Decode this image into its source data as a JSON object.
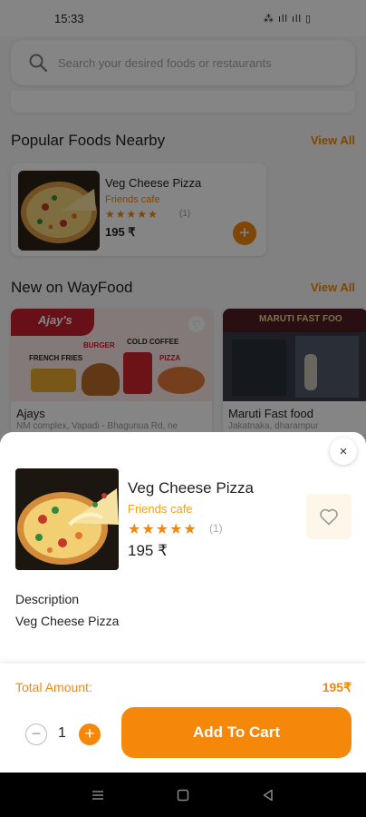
{
  "status_bar": {
    "time": "15:33",
    "icons": "⁂ ıll ıll ▯"
  },
  "search": {
    "placeholder": "Search your desired foods or restaurants"
  },
  "popular": {
    "title": "Popular Foods Nearby",
    "view_all": "View All",
    "item": {
      "name": "Veg Cheese Pizza",
      "restaurant": "Friends cafe",
      "stars": "★★★★★",
      "rating_count": "(1)",
      "price": "195 ₹"
    }
  },
  "new_on": {
    "title": "New on WayFood",
    "view_all": "View All",
    "items": [
      {
        "name": "Ajays",
        "address": "NM complex, Vapadi - Bhagunua Rd, ne",
        "logo": "Ajay's",
        "promo": [
          "BURGER",
          "COLD COFFEE",
          "FRENCH FRIES",
          "PIZZA"
        ]
      },
      {
        "name": "Maruti Fast food",
        "address": "Jakatnaka, dharampur",
        "sign": "MARUTI FAST FOO"
      }
    ]
  },
  "modal": {
    "close_icon": "×",
    "item_name": "Veg Cheese Pizza",
    "restaurant": "Friends cafe",
    "stars": "★★★★★",
    "rating_count": "(1)",
    "price": "195 ₹",
    "description_label": "Description",
    "description": "Veg Cheese Pizza",
    "total_label": "Total Amount:",
    "total_value": "195₹",
    "quantity": "1",
    "minus": "−",
    "plus": "+",
    "add_to_cart": "Add To Cart"
  },
  "colors": {
    "accent": "#f5870a",
    "accent_light": "#fff6ea"
  }
}
